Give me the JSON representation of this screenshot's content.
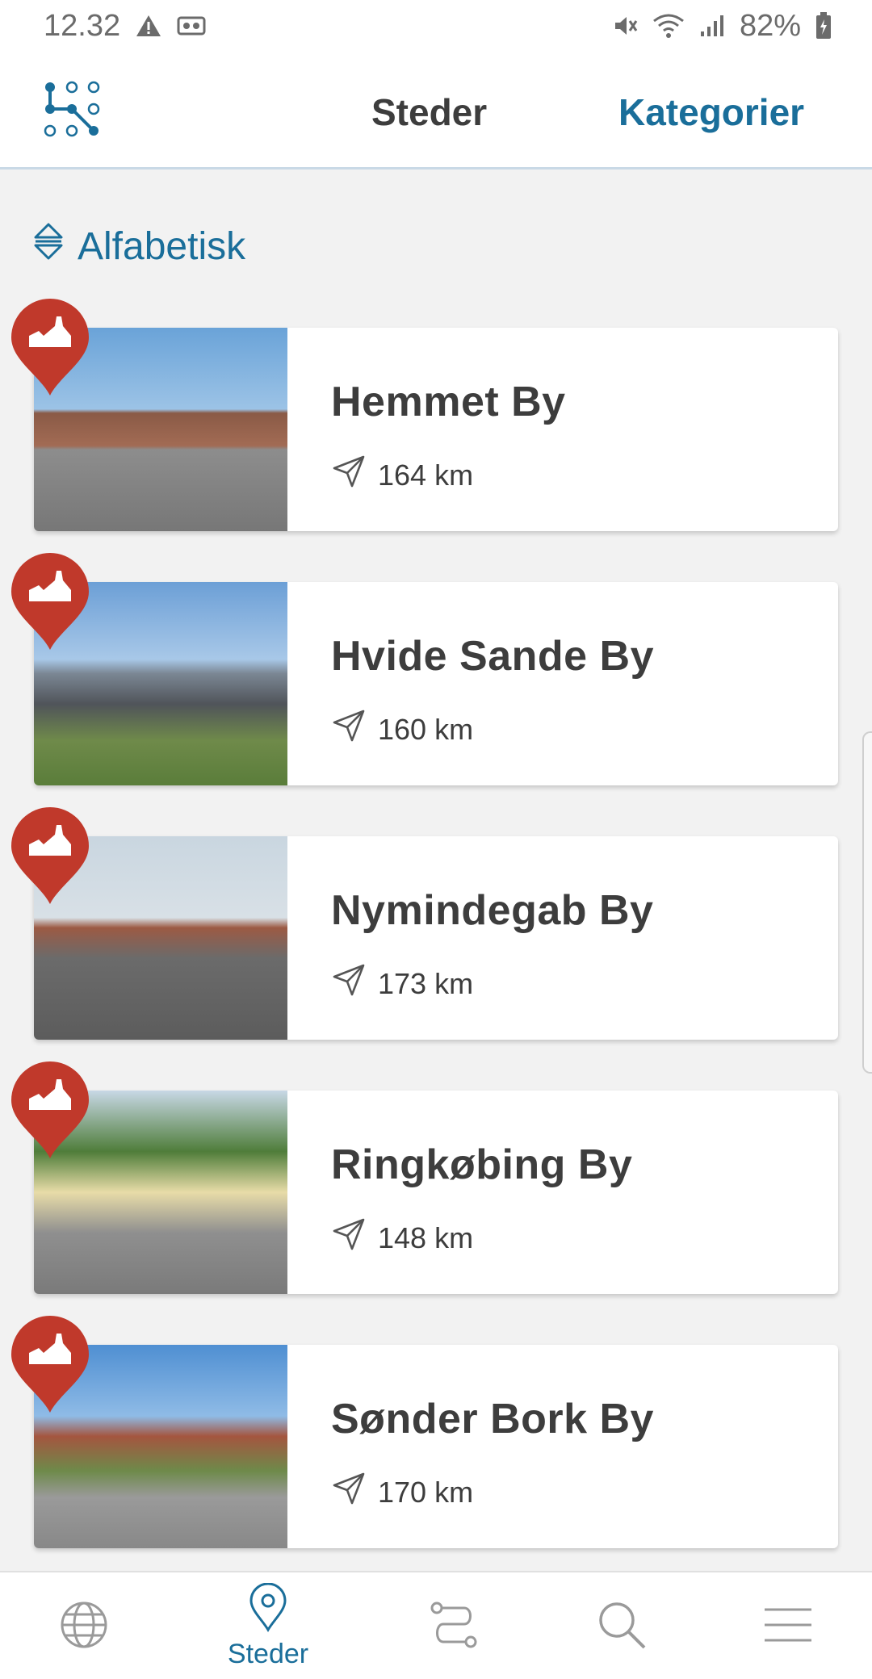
{
  "status_bar": {
    "time": "12.32",
    "battery": "82%",
    "icons": [
      "warning-icon",
      "vr-icon",
      "mute-icon",
      "wifi-icon",
      "signal-icon",
      "battery-icon"
    ]
  },
  "header": {
    "logo_icon": "dots-logo-icon",
    "tabs": [
      {
        "label": "Steder",
        "active": false
      },
      {
        "label": "Kategorier",
        "active": true
      }
    ]
  },
  "sort": {
    "icon": "sort-icon",
    "label": "Alfabetisk"
  },
  "places": [
    {
      "name": "Hemmet By",
      "distance": "164 km",
      "category_icon": "city-pin-icon"
    },
    {
      "name": "Hvide Sande By",
      "distance": "160 km",
      "category_icon": "city-pin-icon"
    },
    {
      "name": "Nymindegab By",
      "distance": "173 km",
      "category_icon": "city-pin-icon"
    },
    {
      "name": "Ringkøbing By",
      "distance": "148 km",
      "category_icon": "city-pin-icon"
    },
    {
      "name": "Sønder Bork By",
      "distance": "170 km",
      "category_icon": "city-pin-icon"
    }
  ],
  "bottom_nav": [
    {
      "icon": "globe-icon",
      "label": ""
    },
    {
      "icon": "location-pin-icon",
      "label": "Steder",
      "active": true
    },
    {
      "icon": "route-icon",
      "label": ""
    },
    {
      "icon": "search-icon",
      "label": ""
    },
    {
      "icon": "menu-icon",
      "label": ""
    }
  ],
  "colors": {
    "accent": "#1a6e9a",
    "pin_red": "#c0392b",
    "text": "#3d3d3d",
    "background": "#f2f2f2"
  }
}
